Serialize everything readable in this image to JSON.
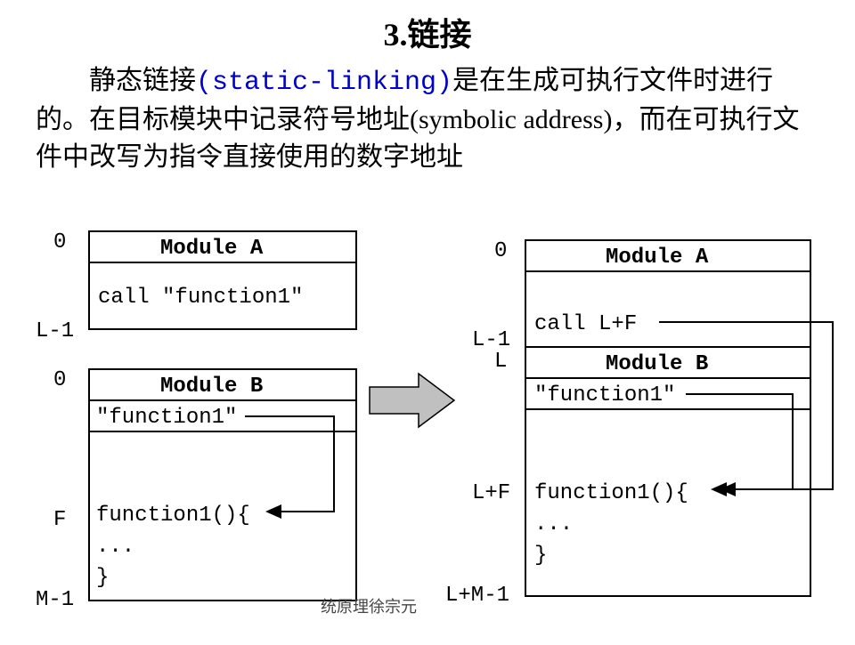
{
  "title": "3.链接",
  "para_pre": "静态链接",
  "para_blue": "(static-linking)",
  "para_post": "是在生成可执行文件时进行的。在目标模块中记录符号地址(symbolic address)，而在可执行文件中改写为指令直接使用的数字地址",
  "left": {
    "a": {
      "title": "Module A",
      "call": "call \"function1\"",
      "t0": "0",
      "t1": "L-1"
    },
    "b": {
      "title": "Module B",
      "sym": "\"function1\"",
      "body1": "function1(){",
      "body2": "...",
      "body3": "}",
      "t0": "0",
      "tF": "F",
      "tM": "M-1"
    }
  },
  "right": {
    "a": {
      "title": "Module A",
      "call": "call L+F"
    },
    "b": {
      "title": "Module B",
      "sym": "\"function1\"",
      "body1": "function1(){",
      "body2": "...",
      "body3": "}"
    },
    "t0": "0",
    "tL1": "L-1",
    "tL": "L",
    "tLF": "L+F",
    "tLM": "L+M-1"
  },
  "footer": "统原理徐宗元"
}
